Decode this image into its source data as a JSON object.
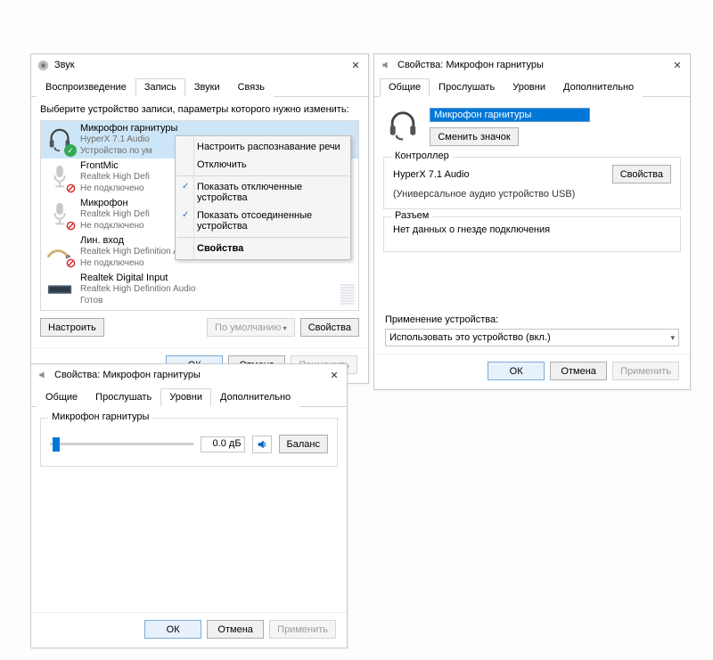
{
  "soundWin": {
    "title": "Звук",
    "tabs": [
      "Воспроизведение",
      "Запись",
      "Звуки",
      "Связь"
    ],
    "activeTab": 1,
    "instruction": "Выберите устройство записи, параметры которого нужно изменить:",
    "devices": [
      {
        "name": "Микрофон гарнитуры",
        "sub1": "HyperX 7.1 Audio",
        "sub2": "Устройство по ум",
        "selected": true,
        "badge": "ok",
        "icon": "headset"
      },
      {
        "name": "FrontMic",
        "sub1": "Realtek High Defi",
        "sub2": "Не подключено",
        "badge": "off",
        "icon": "mic"
      },
      {
        "name": "Микрофон",
        "sub1": "Realtek High Defi",
        "sub2": "Не подключено",
        "badge": "off",
        "icon": "mic"
      },
      {
        "name": "Лин. вход",
        "sub1": "Realtek High Definition Audio",
        "sub2": "Не подключено",
        "badge": "off",
        "icon": "linein"
      },
      {
        "name": "Realtek Digital Input",
        "sub1": "Realtek High Definition Audio",
        "sub2": "Готов",
        "badge": "none",
        "icon": "digital"
      }
    ],
    "context": {
      "items": [
        {
          "label": "Настроить распознавание речи"
        },
        {
          "label": "Отключить"
        },
        {
          "sep": true
        },
        {
          "label": "Показать отключенные устройства",
          "checked": true
        },
        {
          "label": "Показать отсоединенные устройства",
          "checked": true
        },
        {
          "sep": true
        },
        {
          "label": "Свойства",
          "bold": true
        }
      ]
    },
    "btn_configure": "Настроить",
    "btn_default": "По умолчанию",
    "btn_props": "Свойства",
    "btn_ok": "ОК",
    "btn_cancel": "Отмена",
    "btn_apply": "Применить"
  },
  "propsWin": {
    "title": "Свойства: Микрофон гарнитуры",
    "tabs": [
      "Общие",
      "Прослушать",
      "Уровни",
      "Дополнительно"
    ],
    "activeTab": 0,
    "deviceName": "Микрофон гарнитуры",
    "changeIcon": "Сменить значок",
    "controller": {
      "legend": "Контроллер",
      "name": "HyperX 7.1 Audio",
      "desc": "(Универсальное аудио устройство USB)",
      "btn": "Свойства"
    },
    "jack": {
      "legend": "Разъем",
      "text": "Hет данных о гнезде подключения"
    },
    "usageLabel": "Применение устройства:",
    "usageValue": "Использовать это устройство (вкл.)",
    "btn_ok": "ОК",
    "btn_cancel": "Отмена",
    "btn_apply": "Применить"
  },
  "levelsWin": {
    "title": "Свойства: Микрофон гарнитуры",
    "tabs": [
      "Общие",
      "Прослушать",
      "Уровни",
      "Дополнительно"
    ],
    "activeTab": 2,
    "sliderLabel": "Микрофон гарнитуры",
    "value": "0.0 дБ",
    "balance": "Баланс",
    "btn_ok": "ОК",
    "btn_cancel": "Отмена",
    "btn_apply": "Применить"
  }
}
